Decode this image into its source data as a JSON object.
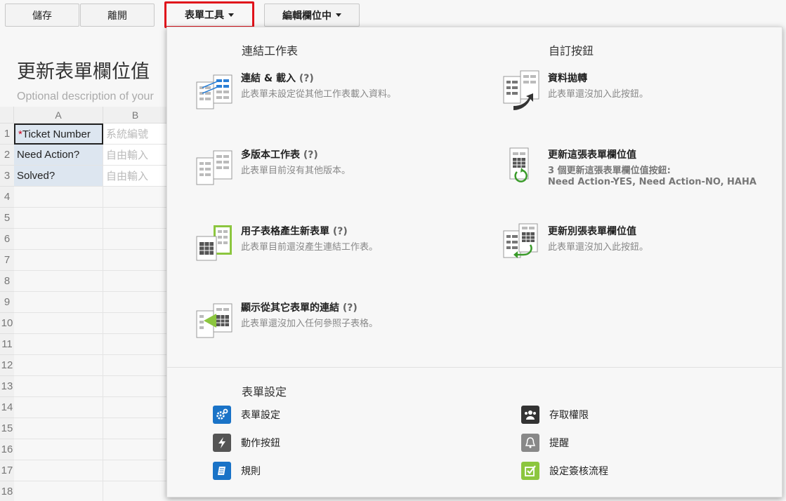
{
  "toolbar": {
    "save": "儲存",
    "leave": "離開",
    "form_tools": "表單工具",
    "edit_fields": "編輯欄位中"
  },
  "form": {
    "title": "更新表單欄位值",
    "description": "Optional description of your"
  },
  "grid": {
    "columns": [
      "A",
      "B"
    ],
    "rows": [
      {
        "num": "1",
        "a": "Ticket Number",
        "required": "*",
        "b": "系統編號"
      },
      {
        "num": "2",
        "a": "Need Action?",
        "b": "自由輸入"
      },
      {
        "num": "3",
        "a": "Solved?",
        "b": "自由輸入"
      },
      {
        "num": "4"
      },
      {
        "num": "5"
      },
      {
        "num": "6"
      },
      {
        "num": "7"
      },
      {
        "num": "8"
      },
      {
        "num": "9"
      },
      {
        "num": "10"
      },
      {
        "num": "11"
      },
      {
        "num": "12"
      },
      {
        "num": "13"
      },
      {
        "num": "14"
      },
      {
        "num": "15"
      },
      {
        "num": "16"
      },
      {
        "num": "17"
      },
      {
        "num": "18"
      }
    ]
  },
  "menu": {
    "linked_sheets": {
      "title": "連結工作表",
      "items": [
        {
          "title": "連結 & 載入",
          "help": "(?)",
          "desc": "此表單未設定從其他工作表載入資料。"
        },
        {
          "title": "多版本工作表",
          "help": "(?)",
          "desc": "此表單目前沒有其他版本。"
        },
        {
          "title": "用子表格產生新表單",
          "help": "(?)",
          "desc": "此表單目前還沒產生連結工作表。"
        },
        {
          "title": "顯示從其它表單的連結",
          "help": "(?)",
          "desc": "此表單還沒加入任何參照子表格。"
        }
      ]
    },
    "custom_buttons": {
      "title": "自訂按鈕",
      "items": [
        {
          "title": "資料拋轉",
          "desc": "此表單還沒加入此按鈕。"
        },
        {
          "title": "更新這張表單欄位值",
          "desc": "3 個更新這張表單欄位值按鈕:",
          "desc2": "Need Action-YES, Need Action-NO, HAHA"
        },
        {
          "title": "更新別張表單欄位值",
          "desc": "此表單還沒加入此按鈕。"
        }
      ]
    },
    "form_settings": {
      "title": "表單設定",
      "items": [
        {
          "label": "表單設定",
          "icon": "gear-icon"
        },
        {
          "label": "存取權限",
          "icon": "users-icon"
        },
        {
          "label": "動作按鈕",
          "icon": "lightning-icon"
        },
        {
          "label": "提醒",
          "icon": "bell-icon"
        },
        {
          "label": "規則",
          "icon": "rules-book-icon"
        },
        {
          "label": "設定簽核流程",
          "icon": "checkbox-icon"
        }
      ]
    }
  },
  "colors": {
    "highlight_border": "#e0121b",
    "settings_blue": "#1a73c7",
    "sheet_green": "#8cc63f",
    "link_blue": "#2a7fd6"
  }
}
